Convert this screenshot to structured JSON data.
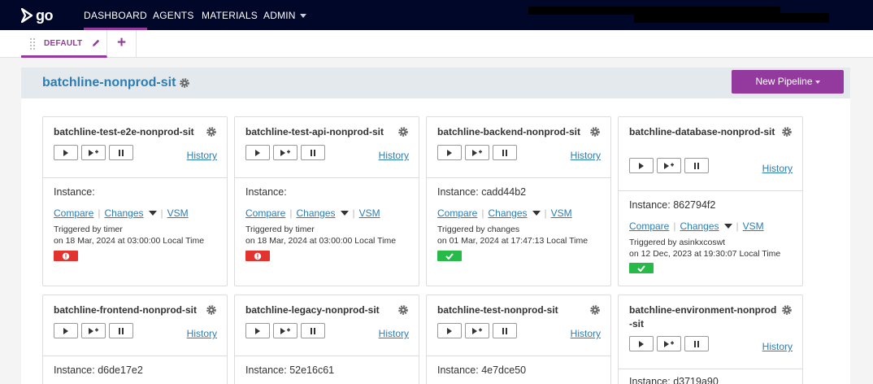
{
  "app": {
    "logo_text": "go"
  },
  "nav": {
    "items": [
      {
        "label": "DASHBOARD",
        "active": true
      },
      {
        "label": "AGENTS",
        "active": false
      },
      {
        "label": "MATERIALS",
        "active": false
      },
      {
        "label": "ADMIN",
        "active": false,
        "dropdown": true
      }
    ]
  },
  "tabs": {
    "items": [
      {
        "label": "DEFAULT",
        "active": true,
        "icon": "pencil-icon"
      }
    ],
    "add_label": "+"
  },
  "group": {
    "title": "batchline-nonprod-sit",
    "new_pipeline_label": "New Pipeline"
  },
  "colors": {
    "nav_bg": "#000728",
    "accent": "#943a9e",
    "link": "#2d7db3",
    "failed": "#e3332f",
    "passed": "#27ba49",
    "group_header_bg": "#e3e9ec"
  },
  "cards": [
    {
      "name": "batchline-test-e2e-nonprod-sit",
      "history": "History",
      "instance": "Instance:",
      "compare": "Compare",
      "changes": "Changes",
      "vsm": "VSM",
      "triggered_by": "Triggered by timer",
      "triggered_on": "on 18 Mar, 2024 at 03:00:00 Local Time",
      "status": "failed"
    },
    {
      "name": "batchline-test-api-nonprod-sit",
      "history": "History",
      "instance": "Instance:",
      "compare": "Compare",
      "changes": "Changes",
      "vsm": "VSM",
      "triggered_by": "Triggered by timer",
      "triggered_on": "on 18 Mar, 2024 at 03:00:00 Local Time",
      "status": "failed"
    },
    {
      "name": "batchline-backend-nonprod-sit",
      "history": "History",
      "instance": "Instance: cadd44b2",
      "compare": "Compare",
      "changes": "Changes",
      "vsm": "VSM",
      "triggered_by": "Triggered by changes",
      "triggered_on": "on 01 Mar, 2024 at 17:47:13 Local Time",
      "status": "passed"
    },
    {
      "name": "batchline-database-nonprod-sit",
      "history": "History",
      "instance": "Instance: 862794f2",
      "compare": "Compare",
      "changes": "Changes",
      "vsm": "VSM",
      "triggered_by": "Triggered by asinkxcoswt",
      "triggered_on": "on 12 Dec, 2023 at 19:30:07 Local Time",
      "status": "passed"
    },
    {
      "name": "batchline-frontend-nonprod-sit",
      "history": "History",
      "instance": "Instance: d6de17e2"
    },
    {
      "name": "batchline-legacy-nonprod-sit",
      "history": "History",
      "instance": "Instance: 52e16c61"
    },
    {
      "name": "batchline-test-nonprod-sit",
      "history": "History",
      "instance": "Instance: 4e7dce50"
    },
    {
      "name": "batchline-environment-nonprod-sit",
      "history": "History",
      "instance": "Instance: d3719a90"
    }
  ]
}
